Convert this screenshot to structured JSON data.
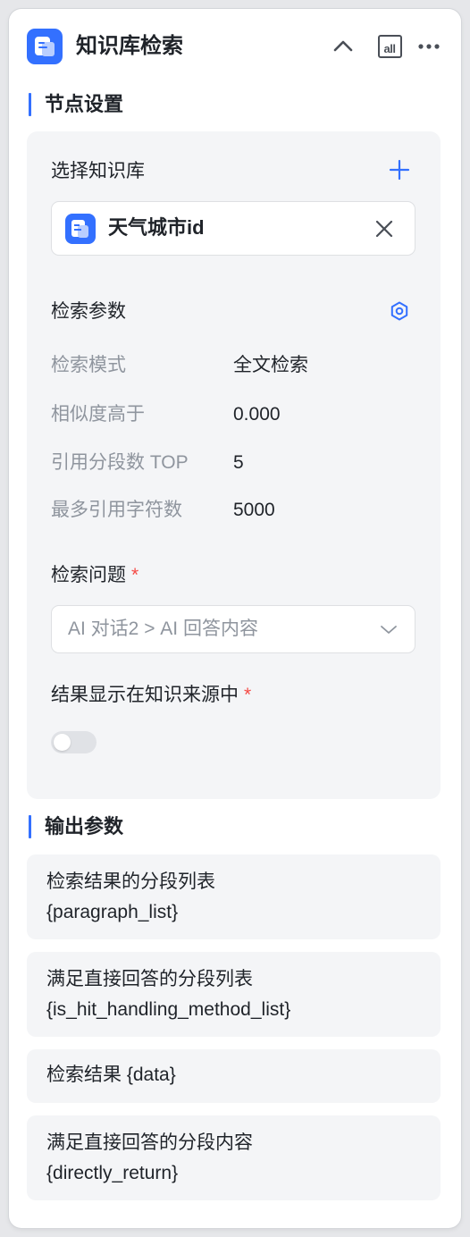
{
  "header": {
    "title": "知识库检索",
    "all_label": "all",
    "icons": [
      "knowledge-base-icon",
      "chevron-up-icon",
      "all-icon",
      "more-icon"
    ]
  },
  "node_settings": {
    "section_title": "节点设置",
    "select_kb_label": "选择知识库",
    "selected_kb": "天气城市id",
    "search_params_label": "检索参数",
    "params": [
      {
        "label": "检索模式",
        "value": "全文检索"
      },
      {
        "label": "相似度高于",
        "value": "0.000"
      },
      {
        "label": "引用分段数 TOP",
        "value": "5"
      },
      {
        "label": "最多引用字符数",
        "value": "5000"
      }
    ],
    "question_label": "检索问题",
    "question_value": "AI 对话2 > AI 回答内容",
    "show_source_label": "结果显示在知识来源中",
    "required_mark": "*",
    "show_source_enabled": false
  },
  "output": {
    "section_title": "输出参数",
    "items": [
      {
        "title": "检索结果的分段列表",
        "var": "{paragraph_list}"
      },
      {
        "title": "满足直接回答的分段列表",
        "var": "{is_hit_handling_method_list}"
      },
      {
        "title": "检索结果 {data}",
        "var": ""
      },
      {
        "title": "满足直接回答的分段内容",
        "var": "{directly_return}"
      }
    ]
  },
  "colors": {
    "accent": "#3370ff",
    "required": "#f54a45",
    "panel_bg": "#f4f5f7"
  }
}
